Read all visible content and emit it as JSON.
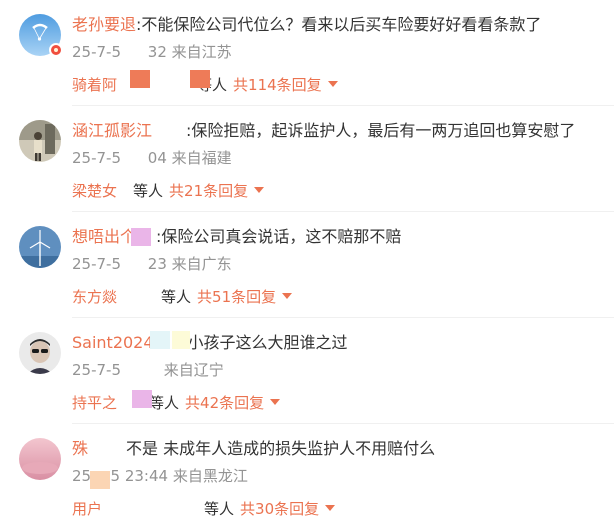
{
  "colors": {
    "accent": "#eb7350",
    "text": "#333333",
    "meta": "#939393"
  },
  "comments": [
    {
      "avatar_icon": "paraglider-avatar-icon",
      "username": "老孙要退",
      "text": ":不能保险公司代位么？看来以后买车险要好好看看条款了",
      "time": "25-7-5 ",
      "time2": "32 来自江苏",
      "reply_name": "骑着阿",
      "and_others": "等人",
      "reply_count": "共114条回复"
    },
    {
      "avatar_icon": "standing-person-avatar-icon",
      "username": "涵江孤影江",
      "text": ":保险拒赔，起诉监护人，最后有一两万追回也算安慰了",
      "time": "25-7-5 ",
      "time2": "04 来自福建",
      "reply_name": "梁楚女",
      "and_others": "等人",
      "reply_count": "共21条回复"
    },
    {
      "avatar_icon": "wind-turbine-avatar-icon",
      "username": "想唔出个",
      "text": ":保险公司真会说话，这不赔那不赔",
      "time": "25-7-5 ",
      "time2": "23 来自广东",
      "reply_name": "东方燚",
      "and_others": "等人",
      "reply_count": "共51条回复"
    },
    {
      "avatar_icon": "sunglasses-person-avatar-icon",
      "username": "Saint2024",
      "text": "小孩子这么大胆谁之过",
      "time": "25-7-5 ",
      "time2": "来自辽宁",
      "reply_name": "持平之",
      "and_others": "等人",
      "reply_count": "共42条回复"
    },
    {
      "avatar_icon": "pink-gradient-avatar-icon",
      "username": "殊",
      "text": "不是 未成年人造成的损失监护人不用赔付么",
      "time": "25",
      "time2": "-5 23:44 来自黑龙江",
      "reply_name": "用户",
      "and_others": "等人",
      "reply_count": "共30条回复"
    }
  ]
}
